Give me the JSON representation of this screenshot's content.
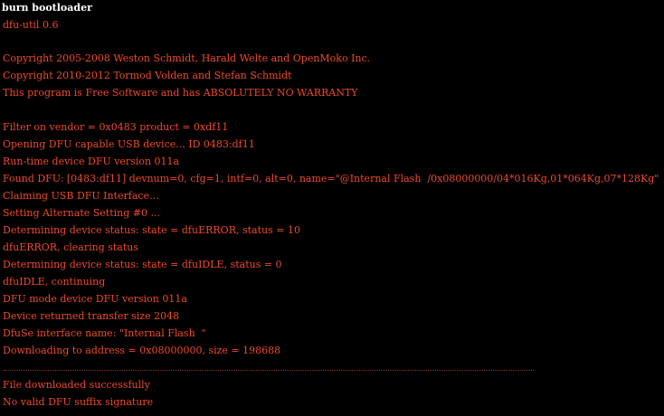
{
  "console": {
    "title": "burn bootloader",
    "lines": [
      "dfu-util 0.6",
      "Copyright 2005-2008 Weston Schmidt, Harald Welte and OpenMoko Inc.",
      "Copyright 2010-2012 Tormod Volden and Stefan Schmidt",
      "This program is Free Software and has ABSOLUTELY NO WARRANTY",
      "Filter on vendor = 0x0483 product = 0xdf11",
      "Opening DFU capable USB device... ID 0483:df11",
      "Run-time device DFU version 011a",
      "Found DFU: [0483:df11] devnum=0, cfg=1, intf=0, alt=0, name=\"@Internal Flash  /0x08000000/04*016Kg,01*064Kg,07*128Kg\"",
      "Claiming USB DFU Interface...",
      "Setting Alternate Setting #0 ...",
      "Determining device status: state = dfuERROR, status = 10",
      "dfuERROR, clearing status",
      "Determining device status: state = dfuIDLE, status = 0",
      "dfuIDLE, continuing",
      "DFU mode device DFU version 011a",
      "Device returned transfer size 2048",
      "DfuSe interface name: \"Internal Flash  \"",
      "Downloading to address = 0x08000000, size = 198688",
      "File downloaded successfully",
      "No valid DFU suffix signature"
    ]
  },
  "colors": {
    "background": "#000000",
    "title": "#ffffff",
    "output": "#ee4a2b"
  }
}
